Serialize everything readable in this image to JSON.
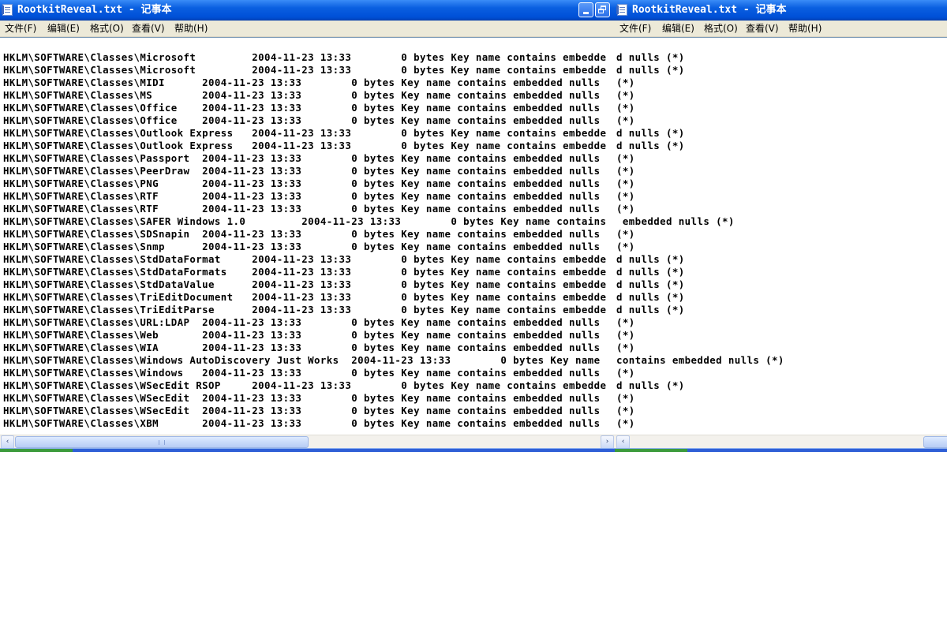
{
  "windows": [
    {
      "title": "RootkitReveal.txt - 记事本",
      "menu": [
        "文件(F)",
        "编辑(E)",
        "格式(O)",
        "查看(V)",
        "帮助(H)"
      ],
      "lines": [
        "HKLM\\SOFTWARE\\Classes\\Microsoft         2004-11-23 13:33        0 bytes Key name contains embedde",
        "HKLM\\SOFTWARE\\Classes\\Microsoft         2004-11-23 13:33        0 bytes Key name contains embedde",
        "HKLM\\SOFTWARE\\Classes\\MIDI      2004-11-23 13:33        0 bytes Key name contains embedded nulls",
        "HKLM\\SOFTWARE\\Classes\\MS        2004-11-23 13:33        0 bytes Key name contains embedded nulls",
        "HKLM\\SOFTWARE\\Classes\\Office    2004-11-23 13:33        0 bytes Key name contains embedded nulls",
        "HKLM\\SOFTWARE\\Classes\\Office    2004-11-23 13:33        0 bytes Key name contains embedded nulls",
        "HKLM\\SOFTWARE\\Classes\\Outlook Express   2004-11-23 13:33        0 bytes Key name contains embedde",
        "HKLM\\SOFTWARE\\Classes\\Outlook Express   2004-11-23 13:33        0 bytes Key name contains embedde",
        "HKLM\\SOFTWARE\\Classes\\Passport  2004-11-23 13:33        0 bytes Key name contains embedded nulls",
        "HKLM\\SOFTWARE\\Classes\\PeerDraw  2004-11-23 13:33        0 bytes Key name contains embedded nulls",
        "HKLM\\SOFTWARE\\Classes\\PNG       2004-11-23 13:33        0 bytes Key name contains embedded nulls",
        "HKLM\\SOFTWARE\\Classes\\RTF       2004-11-23 13:33        0 bytes Key name contains embedded nulls",
        "HKLM\\SOFTWARE\\Classes\\RTF       2004-11-23 13:33        0 bytes Key name contains embedded nulls",
        "HKLM\\SOFTWARE\\Classes\\SAFER Windows 1.0         2004-11-23 13:33        0 bytes Key name contains",
        "HKLM\\SOFTWARE\\Classes\\SDSnapin  2004-11-23 13:33        0 bytes Key name contains embedded nulls",
        "HKLM\\SOFTWARE\\Classes\\Snmp      2004-11-23 13:33        0 bytes Key name contains embedded nulls",
        "HKLM\\SOFTWARE\\Classes\\StdDataFormat     2004-11-23 13:33        0 bytes Key name contains embedde",
        "HKLM\\SOFTWARE\\Classes\\StdDataFormats    2004-11-23 13:33        0 bytes Key name contains embedde",
        "HKLM\\SOFTWARE\\Classes\\StdDataValue      2004-11-23 13:33        0 bytes Key name contains embedde",
        "HKLM\\SOFTWARE\\Classes\\TriEditDocument   2004-11-23 13:33        0 bytes Key name contains embedde",
        "HKLM\\SOFTWARE\\Classes\\TriEditParse      2004-11-23 13:33        0 bytes Key name contains embedde",
        "HKLM\\SOFTWARE\\Classes\\URL:LDAP  2004-11-23 13:33        0 bytes Key name contains embedded nulls",
        "HKLM\\SOFTWARE\\Classes\\Web       2004-11-23 13:33        0 bytes Key name contains embedded nulls",
        "HKLM\\SOFTWARE\\Classes\\WIA       2004-11-23 13:33        0 bytes Key name contains embedded nulls",
        "HKLM\\SOFTWARE\\Classes\\Windows AutoDiscovery Just Works  2004-11-23 13:33        0 bytes Key name",
        "HKLM\\SOFTWARE\\Classes\\Windows   2004-11-23 13:33        0 bytes Key name contains embedded nulls",
        "HKLM\\SOFTWARE\\Classes\\WSecEdit RSOP     2004-11-23 13:33        0 bytes Key name contains embedde",
        "HKLM\\SOFTWARE\\Classes\\WSecEdit  2004-11-23 13:33        0 bytes Key name contains embedded nulls",
        "HKLM\\SOFTWARE\\Classes\\WSecEdit  2004-11-23 13:33        0 bytes Key name contains embedded nulls",
        "HKLM\\SOFTWARE\\Classes\\XBM       2004-11-23 13:33        0 bytes Key name contains embedded nulls"
      ]
    },
    {
      "title": "RootkitReveal.txt - 记事本",
      "menu": [
        "文件(F)",
        "编辑(E)",
        "格式(O)",
        "查看(V)",
        "帮助(H)"
      ],
      "lines": [
        "d nulls (*)",
        "d nulls (*)",
        "(*)",
        "(*)",
        "(*)",
        "(*)",
        "d nulls (*)",
        "d nulls (*)",
        "(*)",
        "(*)",
        "(*)",
        "(*)",
        "(*)",
        " embedded nulls (*)",
        "(*)",
        "(*)",
        "d nulls (*)",
        "d nulls (*)",
        "d nulls (*)",
        "d nulls (*)",
        "d nulls (*)",
        "(*)",
        "(*)",
        "(*)",
        "contains embedded nulls (*)",
        "(*)",
        "d nulls (*)",
        "(*)",
        "(*)",
        "(*)"
      ]
    }
  ],
  "icons": {
    "left_arrow": "‹",
    "right_arrow": "›"
  },
  "colors": {
    "titlebar": "#0a5fe0",
    "menubar": "#ece9d8"
  }
}
